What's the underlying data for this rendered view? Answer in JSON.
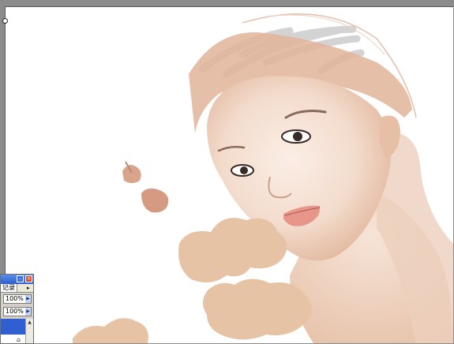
{
  "canvas": {
    "subject": "digital painting in progress",
    "palette": {
      "skin": "#f2d9c9",
      "skin_shadow": "#d9a98c",
      "paint_blob": "#e6c3a5",
      "hair": "#d0d0d0",
      "lips": "#e8958a",
      "background": "#ffffff"
    }
  },
  "panel": {
    "tab_label": "记录",
    "opacity_value": "100%",
    "flow_value": "100%",
    "title_buttons": {
      "minimize": "minimize-icon",
      "close": "close-icon"
    }
  }
}
